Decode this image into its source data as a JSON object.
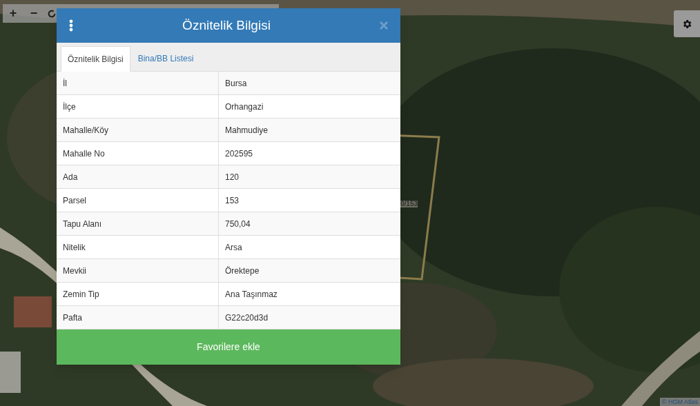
{
  "map_controls": [
    {
      "label": "+"
    },
    {
      "label": "−"
    }
  ],
  "parcel_label": "0/153",
  "attribution": "© HGM Atlas",
  "dialog": {
    "title": "Öznitelik Bilgisi",
    "tabs": [
      {
        "label": "Öznitelik Bilgisi",
        "selected": true
      },
      {
        "label": "Bina/BB Listesi",
        "selected": false
      }
    ],
    "rows": [
      {
        "name": "İl",
        "value": "Bursa"
      },
      {
        "name": "İlçe",
        "value": "Orhangazi"
      },
      {
        "name": "Mahalle/Köy",
        "value": "Mahmudiye"
      },
      {
        "name": "Mahalle No",
        "value": "202595"
      },
      {
        "name": "Ada",
        "value": "120"
      },
      {
        "name": "Parsel",
        "value": "153"
      },
      {
        "name": "Tapu Alanı",
        "value": "750,04"
      },
      {
        "name": "Nitelik",
        "value": "Arsa"
      },
      {
        "name": "Mevkii",
        "value": "Örektepe"
      },
      {
        "name": "Zemin Tip",
        "value": "Ana Taşınmaz"
      },
      {
        "name": "Pafta",
        "value": "G22c20d3d"
      }
    ],
    "button": "Favorilere ekle"
  }
}
